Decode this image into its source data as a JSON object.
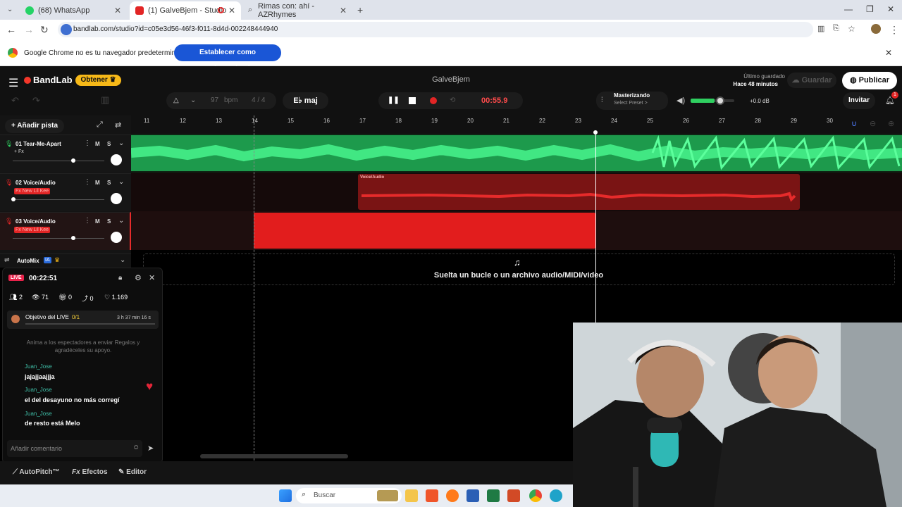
{
  "browser": {
    "tabs": [
      {
        "label": "(68) WhatsApp",
        "active": false
      },
      {
        "label": "(1) GalveBjem - Studio",
        "active": true
      },
      {
        "label": "Rimas con: ahí - AZRhymes",
        "active": false
      }
    ],
    "url": "bandlab.com/studio?id=c05e3d56-46f3-f011-8d4d-002248444940",
    "infobar_message": "Google Chrome no es tu navegador predeterminado",
    "infobar_button": "Establecer como predeterminado"
  },
  "app": {
    "brand": "BandLab",
    "get_button": "Obtener",
    "project_name": "GalveBjem",
    "last_saved_label": "Último guardado",
    "last_saved_value": "Hace 48 minutos",
    "save_button": "Guardar",
    "publish_button": "Publicar",
    "invite_button": "Invitar",
    "notification_count": "1"
  },
  "transport": {
    "bpm_value": "97",
    "bpm_label": "bpm",
    "time_sig": "4 / 4",
    "key": "E♭ maj",
    "time": "00:55.9",
    "mastering_label": "Masterizando",
    "mastering_preset": "Select Preset >",
    "volume": "+0.0 dB"
  },
  "tracks_panel": {
    "add_track": "Añadir pista",
    "tracks": [
      {
        "name": "01  Tear-Me-Apart",
        "fx": "+ Fx",
        "mute": "M",
        "solo": "S"
      },
      {
        "name": "02  Voice/Audio",
        "fx": "Fx New Lil Kee",
        "mute": "M",
        "solo": "S"
      },
      {
        "name": "03  Voice/Audio",
        "fx": "Fx New Lil Kee",
        "mute": "M",
        "solo": "S"
      }
    ],
    "automix": "AutoMix",
    "ia_badge": "IA"
  },
  "timeline": {
    "ticks": [
      "11",
      "12",
      "13",
      "14",
      "15",
      "16",
      "17",
      "18",
      "19",
      "20",
      "21",
      "22",
      "23",
      "24",
      "25",
      "26",
      "27",
      "28",
      "29",
      "30"
    ],
    "clip2_label": "Voice/Audio",
    "drop_text": "Suelta un bucle o un archivo audio/MIDI/video"
  },
  "live": {
    "badge": "LIVE",
    "duration": "00:22:51",
    "stats": {
      "viewers_group": "2",
      "views": "71",
      "gifts": "0",
      "shares": "0",
      "likes": "1.169"
    },
    "goal_label": "Objetivo del LIVE",
    "goal_progress": "0/1",
    "goal_time": "3 h 37 min 16 s",
    "hint": "Anima a los espectadores a enviar Regalos y agradéceles su apoyo.",
    "comments": [
      {
        "user": "Juan_Jose",
        "text": "jajajjaajjja"
      },
      {
        "user": "Juan_Jose",
        "text": "el del desayuno no más corregí"
      },
      {
        "user": "Juan_Jose",
        "text": "de resto está Melo"
      }
    ],
    "comment_placeholder": "Añadir comentario"
  },
  "bottombar": {
    "autopitch": "AutoPitch™",
    "effects": "Efectos",
    "editor": "Editor"
  },
  "taskbar": {
    "search_placeholder": "Buscar"
  },
  "colors": {
    "accent_red": "#e62b2b",
    "track1_green": "#22b35a",
    "publish_white": "#ffffff",
    "obtain_yellow": "#f7b918"
  }
}
